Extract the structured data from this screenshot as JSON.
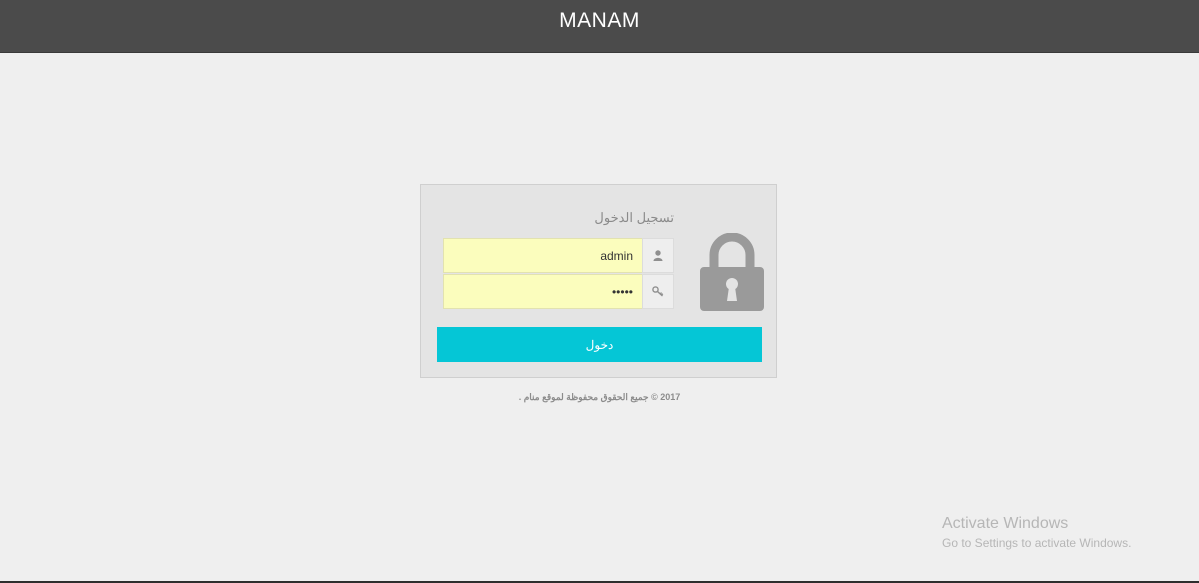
{
  "header": {
    "brand": "MANAM"
  },
  "login": {
    "title": "تسجيل الدخول",
    "username_value": "admin",
    "password_value": "12345",
    "submit_label": "دخول"
  },
  "icons": {
    "lock": "lock-icon",
    "user": "user-icon",
    "key": "key-icon"
  },
  "footer": {
    "copyright": "2017 © جميع الحقوق محفوظة لموقع منام ."
  },
  "os_watermark": {
    "title": "Activate Windows",
    "subtitle": "Go to Settings to activate Windows."
  },
  "colors": {
    "topbar": "#4b4b4b",
    "button": "#05c6d6",
    "field_autofill": "#fbfdbd"
  }
}
